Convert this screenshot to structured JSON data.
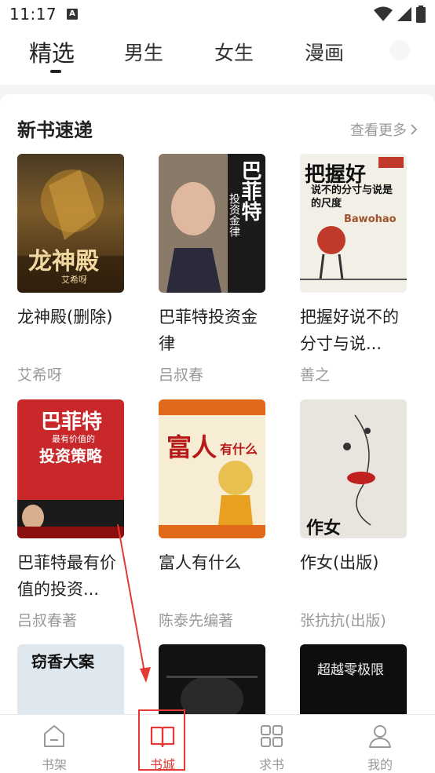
{
  "status": {
    "time": "11:17",
    "badge": "A"
  },
  "tabs": [
    {
      "label": "精选"
    },
    {
      "label": "男生"
    },
    {
      "label": "女生"
    },
    {
      "label": "漫画"
    }
  ],
  "section": {
    "title": "新书速递",
    "more": "查看更多"
  },
  "books": [
    {
      "title": "龙神殿(删除)",
      "author": "艾希呀",
      "cover_text": "龙神殿",
      "cover_author": "艾希呀"
    },
    {
      "title": "巴菲特投资金律",
      "author": "吕叔春",
      "cover_text": "巴菲特",
      "cover_sub": "投资金律"
    },
    {
      "title": "把握好说不的分寸与说...",
      "author": "善之",
      "cover_text": "把握好",
      "cover_sub": "说不的分寸与说是的尺度",
      "cover_en": "Bawohao"
    },
    {
      "title": "巴菲特最有价值的投资...",
      "author": "吕叔春著",
      "cover_text": "巴菲特",
      "cover_sub": "最有价值的",
      "cover_sub2": "投资策略"
    },
    {
      "title": "富人有什么",
      "author": "陈泰先编著",
      "cover_text": "富人",
      "cover_sub": "有什么"
    },
    {
      "title": "作女(出版)",
      "author": "张抗抗(出版)",
      "cover_text": "作女"
    },
    {
      "cover_text": "窃香大案"
    },
    {
      "cover_text": ""
    },
    {
      "cover_text": "超越零极限"
    }
  ],
  "nav": [
    {
      "label": "书架",
      "icon": "bookshelf-icon"
    },
    {
      "label": "书城",
      "icon": "book-open-icon"
    },
    {
      "label": "求书",
      "icon": "grid-icon"
    },
    {
      "label": "我的",
      "icon": "user-icon"
    }
  ],
  "colors": {
    "accent": "#e53935",
    "muted": "#999999"
  }
}
